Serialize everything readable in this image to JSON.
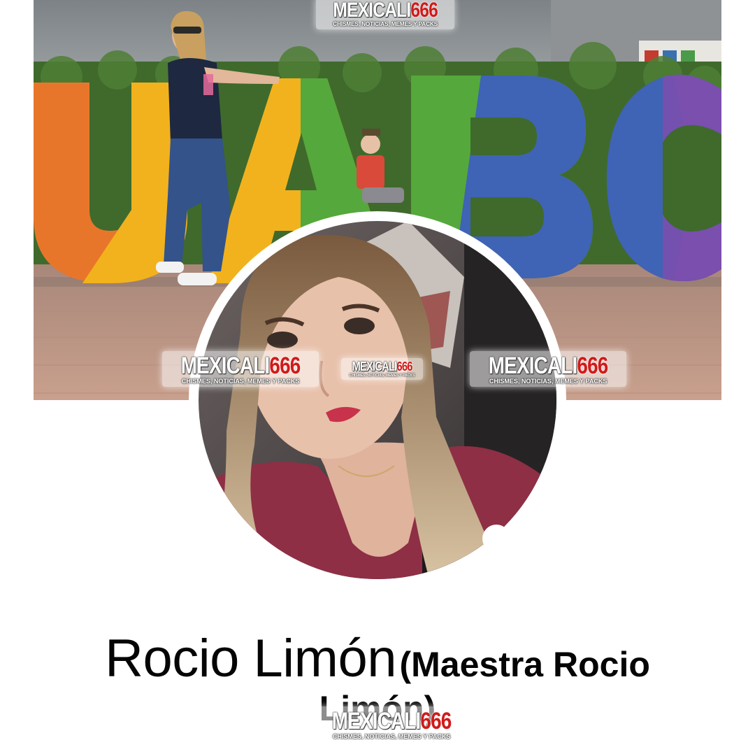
{
  "profile": {
    "name": "Rocio Limón",
    "alternate_name": "(Maestra Rocio Limón)"
  },
  "cover_photo": {
    "sign_text": "UABC",
    "colors": {
      "orange": "#e8762a",
      "yellow": "#f2b21d",
      "green": "#55a83b",
      "blue": "#3f63b5",
      "purple": "#7a4fae",
      "hedge": "#3f6a2c",
      "pavement": "#c49a86"
    }
  },
  "watermark": {
    "brand": "MEXICALI",
    "number": "666",
    "tagline": "CHISMES, NOTICIAS, MEMES Y PACKS",
    "number_color": "#d11a1a"
  }
}
